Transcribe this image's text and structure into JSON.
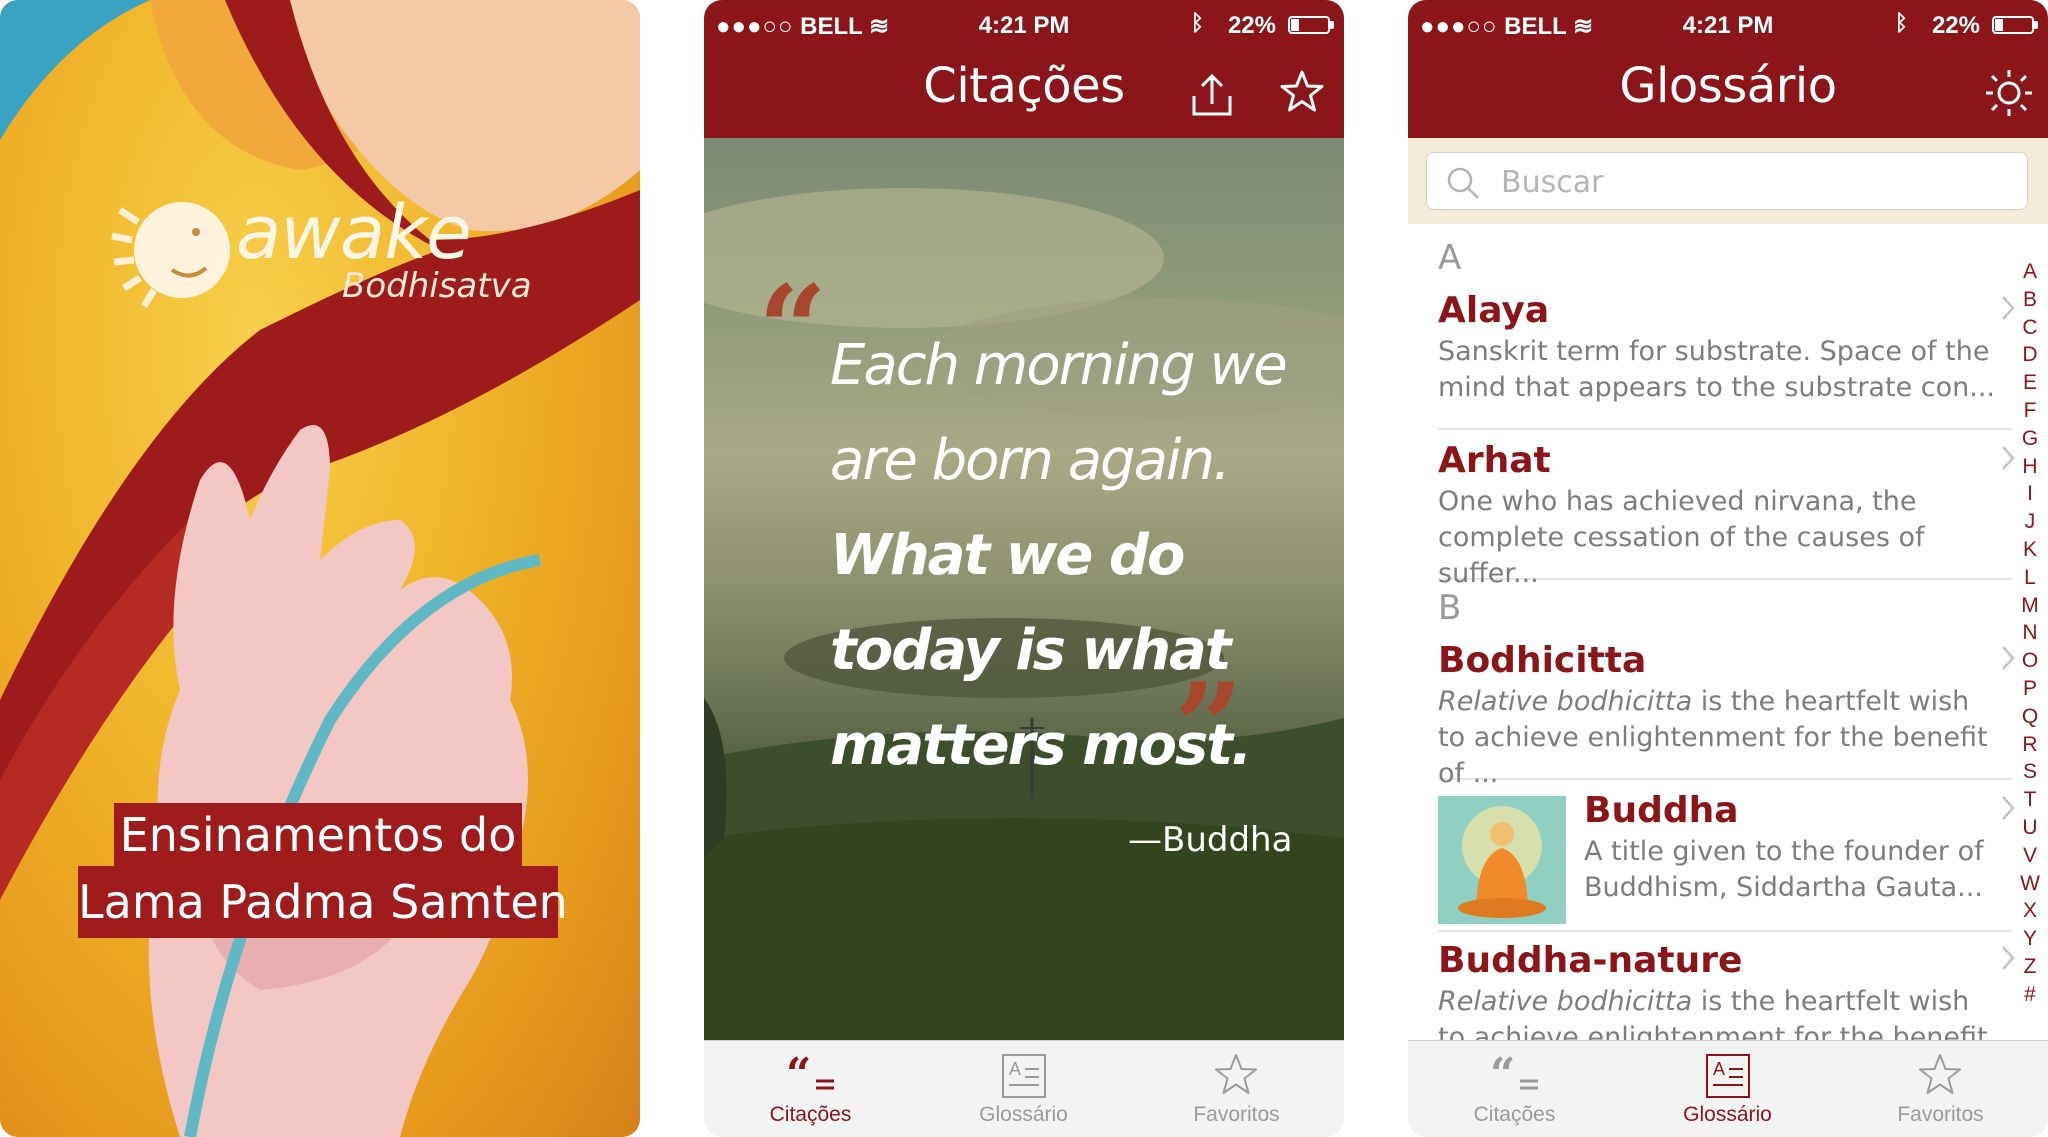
{
  "splash": {
    "logo_word": "awake",
    "logo_sub": "Bodhisatva",
    "caption_line1": "Ensinamentos do",
    "caption_line2": "Lama Padma Samten"
  },
  "status": {
    "carrier": "BELL",
    "time": "4:21 PM",
    "battery": "22%"
  },
  "quotes_screen": {
    "title": "Citações",
    "quote_line1": "Each morning we",
    "quote_line2": "are born again.",
    "quote_line3": "What we do",
    "quote_line4": "today is what",
    "quote_line5": "matters most.",
    "author": "—Buddha"
  },
  "glossary_screen": {
    "title": "Glossário",
    "search_placeholder": "Buscar",
    "section_a": "A",
    "section_b": "B",
    "entries": [
      {
        "term": "Alaya",
        "def": "Sanskrit term for substrate. Space of the mind that appears to the substrate con..."
      },
      {
        "term": "Arhat",
        "def": "One who has achieved nirvana, the complete cessation of the causes of suffer..."
      },
      {
        "term": "Bodhicitta",
        "def_italic": "Relative bodhicitta",
        "def": " is the heartfelt wish to achieve enlightenment for the benefit of ..."
      },
      {
        "term": "Buddha",
        "def": "A title given to the founder of Buddhism, Siddartha Gauta..."
      },
      {
        "term": "Buddha-nature",
        "def_italic": "Relative bodhicitta",
        "def": " is the heartfelt wish to achieve enlightenment for the benefit of ..."
      }
    ],
    "index": [
      "A",
      "B",
      "C",
      "D",
      "E",
      "F",
      "G",
      "H",
      "I",
      "J",
      "K",
      "L",
      "M",
      "N",
      "O",
      "P",
      "Q",
      "R",
      "S",
      "T",
      "U",
      "V",
      "W",
      "X",
      "Y",
      "Z",
      "#"
    ]
  },
  "tabs": {
    "quotes": "Citações",
    "glossary": "Glossário",
    "favorites": "Favoritos"
  },
  "colors": {
    "brand_red": "#8c1519",
    "caption_red": "#a01b1c",
    "search_band": "#f4ecd8"
  }
}
